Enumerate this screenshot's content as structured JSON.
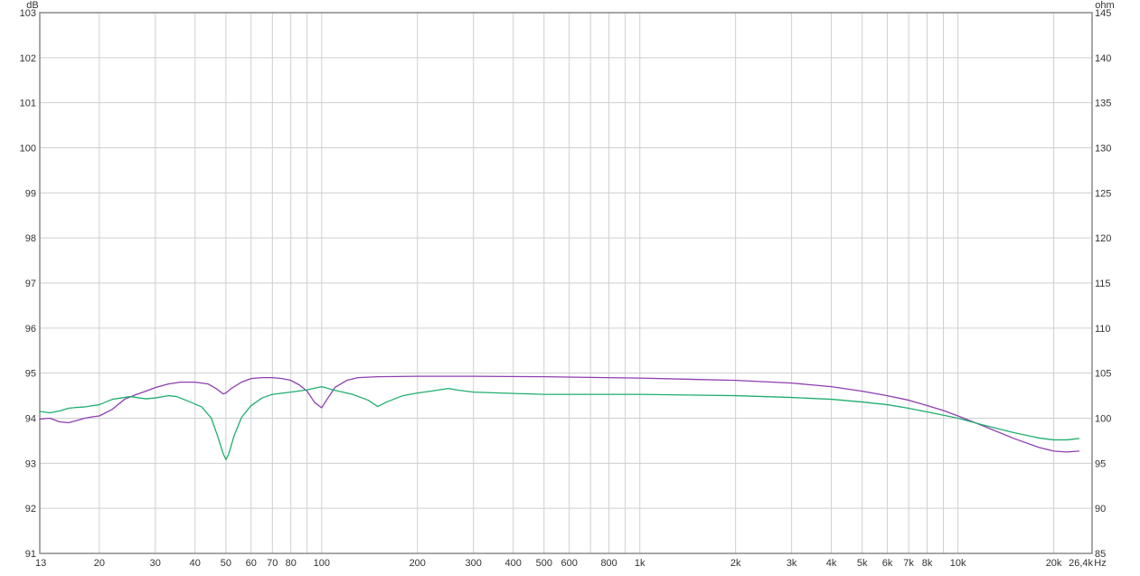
{
  "chart_data": {
    "type": "line",
    "title": "",
    "x_axis": {
      "scale": "log",
      "range": [
        13,
        26400
      ],
      "unit_label": "Hz",
      "major_ticks": [
        {
          "value": 13,
          "label": "13"
        },
        {
          "value": 20,
          "label": "20"
        },
        {
          "value": 30,
          "label": "30"
        },
        {
          "value": 40,
          "label": "40"
        },
        {
          "value": 50,
          "label": "50"
        },
        {
          "value": 60,
          "label": "60"
        },
        {
          "value": 70,
          "label": "70"
        },
        {
          "value": 80,
          "label": "80"
        },
        {
          "value": 100,
          "label": "100"
        },
        {
          "value": 200,
          "label": "200"
        },
        {
          "value": 300,
          "label": "300"
        },
        {
          "value": 400,
          "label": "400"
        },
        {
          "value": 500,
          "label": "500"
        },
        {
          "value": 600,
          "label": "600"
        },
        {
          "value": 800,
          "label": "800"
        },
        {
          "value": 1000,
          "label": "1k"
        },
        {
          "value": 2000,
          "label": "2k"
        },
        {
          "value": 3000,
          "label": "3k"
        },
        {
          "value": 4000,
          "label": "4k"
        },
        {
          "value": 5000,
          "label": "5k"
        },
        {
          "value": 6000,
          "label": "6k"
        },
        {
          "value": 7000,
          "label": "7k"
        },
        {
          "value": 8000,
          "label": "8k"
        },
        {
          "value": 10000,
          "label": "10k"
        },
        {
          "value": 20000,
          "label": "20k"
        },
        {
          "value": 26400,
          "label": "26,4k"
        }
      ],
      "unlabeled_grid": [
        90,
        700,
        900,
        9000
      ]
    },
    "y_axis_left": {
      "unit_label": "dB",
      "range": [
        91,
        103
      ],
      "ticks": [
        "91",
        "92",
        "93",
        "94",
        "95",
        "96",
        "97",
        "98",
        "99",
        "100",
        "101",
        "102",
        "103"
      ]
    },
    "y_axis_right": {
      "unit_label": "ohm",
      "range": [
        85,
        145
      ],
      "ticks": [
        "85",
        "90",
        "95",
        "100",
        "105",
        "110",
        "115",
        "120",
        "125",
        "130",
        "135",
        "140",
        "145"
      ]
    },
    "grid": true,
    "series": [
      {
        "color": "#8e3eb0",
        "points": [
          [
            13,
            93.98
          ],
          [
            14,
            94.0
          ],
          [
            15,
            93.92
          ],
          [
            16,
            93.9
          ],
          [
            17,
            93.95
          ],
          [
            18,
            94.0
          ],
          [
            19,
            94.03
          ],
          [
            20,
            94.05
          ],
          [
            22,
            94.2
          ],
          [
            24,
            94.42
          ],
          [
            26,
            94.52
          ],
          [
            28,
            94.6
          ],
          [
            30,
            94.68
          ],
          [
            33,
            94.76
          ],
          [
            36,
            94.8
          ],
          [
            40,
            94.8
          ],
          [
            44,
            94.76
          ],
          [
            47,
            94.64
          ],
          [
            49,
            94.54
          ],
          [
            50,
            94.56
          ],
          [
            52,
            94.66
          ],
          [
            56,
            94.8
          ],
          [
            60,
            94.88
          ],
          [
            65,
            94.9
          ],
          [
            70,
            94.9
          ],
          [
            75,
            94.88
          ],
          [
            80,
            94.84
          ],
          [
            85,
            94.74
          ],
          [
            90,
            94.6
          ],
          [
            95,
            94.35
          ],
          [
            100,
            94.23
          ],
          [
            104,
            94.42
          ],
          [
            110,
            94.68
          ],
          [
            120,
            94.84
          ],
          [
            130,
            94.9
          ],
          [
            150,
            94.92
          ],
          [
            200,
            94.93
          ],
          [
            300,
            94.93
          ],
          [
            500,
            94.92
          ],
          [
            1000,
            94.89
          ],
          [
            2000,
            94.84
          ],
          [
            3000,
            94.78
          ],
          [
            4000,
            94.7
          ],
          [
            5000,
            94.6
          ],
          [
            6000,
            94.5
          ],
          [
            7000,
            94.4
          ],
          [
            8000,
            94.28
          ],
          [
            9000,
            94.17
          ],
          [
            10000,
            94.05
          ],
          [
            12000,
            93.83
          ],
          [
            15000,
            93.55
          ],
          [
            18000,
            93.35
          ],
          [
            20000,
            93.27
          ],
          [
            22000,
            93.25
          ],
          [
            24000,
            93.27
          ]
        ]
      },
      {
        "color": "#1fae6e",
        "points": [
          [
            13,
            94.15
          ],
          [
            14,
            94.12
          ],
          [
            15,
            94.16
          ],
          [
            16,
            94.22
          ],
          [
            17,
            94.24
          ],
          [
            18,
            94.25
          ],
          [
            20,
            94.3
          ],
          [
            22,
            94.42
          ],
          [
            25,
            94.48
          ],
          [
            28,
            94.43
          ],
          [
            30,
            94.45
          ],
          [
            33,
            94.5
          ],
          [
            35,
            94.48
          ],
          [
            38,
            94.38
          ],
          [
            42,
            94.25
          ],
          [
            45,
            94.0
          ],
          [
            47,
            93.62
          ],
          [
            49,
            93.22
          ],
          [
            50,
            93.08
          ],
          [
            51,
            93.2
          ],
          [
            53,
            93.6
          ],
          [
            56,
            94.02
          ],
          [
            60,
            94.28
          ],
          [
            65,
            94.45
          ],
          [
            70,
            94.53
          ],
          [
            80,
            94.58
          ],
          [
            90,
            94.63
          ],
          [
            100,
            94.7
          ],
          [
            110,
            94.62
          ],
          [
            125,
            94.53
          ],
          [
            140,
            94.4
          ],
          [
            150,
            94.26
          ],
          [
            160,
            94.36
          ],
          [
            180,
            94.5
          ],
          [
            200,
            94.56
          ],
          [
            220,
            94.6
          ],
          [
            250,
            94.66
          ],
          [
            270,
            94.62
          ],
          [
            300,
            94.58
          ],
          [
            400,
            94.55
          ],
          [
            500,
            94.53
          ],
          [
            1000,
            94.53
          ],
          [
            2000,
            94.5
          ],
          [
            3000,
            94.46
          ],
          [
            4000,
            94.42
          ],
          [
            5000,
            94.36
          ],
          [
            6000,
            94.3
          ],
          [
            7000,
            94.22
          ],
          [
            8000,
            94.14
          ],
          [
            10000,
            94.0
          ],
          [
            12000,
            93.85
          ],
          [
            15000,
            93.68
          ],
          [
            18000,
            93.56
          ],
          [
            20000,
            93.52
          ],
          [
            22000,
            93.52
          ],
          [
            24000,
            93.55
          ]
        ]
      }
    ]
  }
}
